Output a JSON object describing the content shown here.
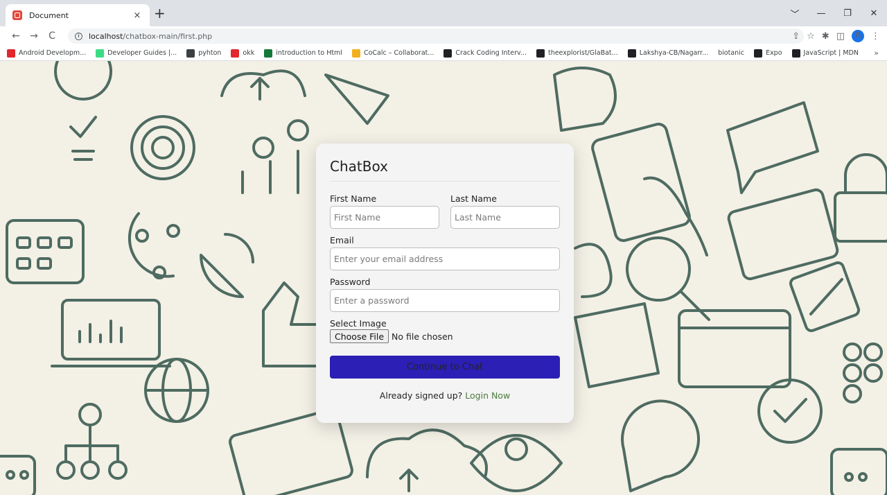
{
  "browser": {
    "tab_title": "Document",
    "tab_close": "×",
    "new_tab": "+",
    "url_host": "localhost",
    "url_path": "/chatbox-main/first.php",
    "avatar_letter": "A",
    "window_controls": [
      "﹀",
      "—",
      "❐",
      "✕"
    ],
    "bookmarks": [
      {
        "label": "Android Developm...",
        "icon": "youtube-icon",
        "color": "#e0282e"
      },
      {
        "label": "Developer Guides |...",
        "icon": "android-icon",
        "color": "#3ddc84"
      },
      {
        "label": "pyhton",
        "icon": "book-icon",
        "color": "#3c4043"
      },
      {
        "label": "okk",
        "icon": "youtube-icon",
        "color": "#e0282e"
      },
      {
        "label": "introduction to Html",
        "icon": "w-icon",
        "color": "#137a3a"
      },
      {
        "label": "CoCalc – Collaborat...",
        "icon": "cocalc-icon",
        "color": "#f2b01e"
      },
      {
        "label": "Crack Coding Interv...",
        "icon": "camera-icon",
        "color": "#202124"
      },
      {
        "label": "theexplorist/GlaBat...",
        "icon": "github-icon",
        "color": "#202124"
      },
      {
        "label": "Lakshya-CB/Nagarr...",
        "icon": "github-icon",
        "color": "#202124"
      },
      {
        "label": "biotanic",
        "icon": "",
        "color": ""
      },
      {
        "label": "Expo",
        "icon": "expo-icon",
        "color": "#202124"
      },
      {
        "label": "JavaScript | MDN",
        "icon": "mdn-icon",
        "color": "#202124"
      }
    ],
    "bookmarks_more": "»"
  },
  "form": {
    "title": "ChatBox",
    "first_name_label": "First Name",
    "first_name_placeholder": "First Name",
    "last_name_label": "Last Name",
    "last_name_placeholder": "Last Name",
    "email_label": "Email",
    "email_placeholder": "Enter your email address",
    "password_label": "Password",
    "password_placeholder": "Enter a password",
    "image_label": "Select Image",
    "file_button": "Choose File",
    "file_status": "No file chosen",
    "submit_label": "Continue to Chat",
    "footer_text": "Already signed up?",
    "footer_link": "Login Now"
  },
  "colors": {
    "submit_bg": "#2b1fb5",
    "link": "#4a7a3c",
    "background_art": "#4e6b61",
    "page_bg": "#f3f0e6"
  }
}
